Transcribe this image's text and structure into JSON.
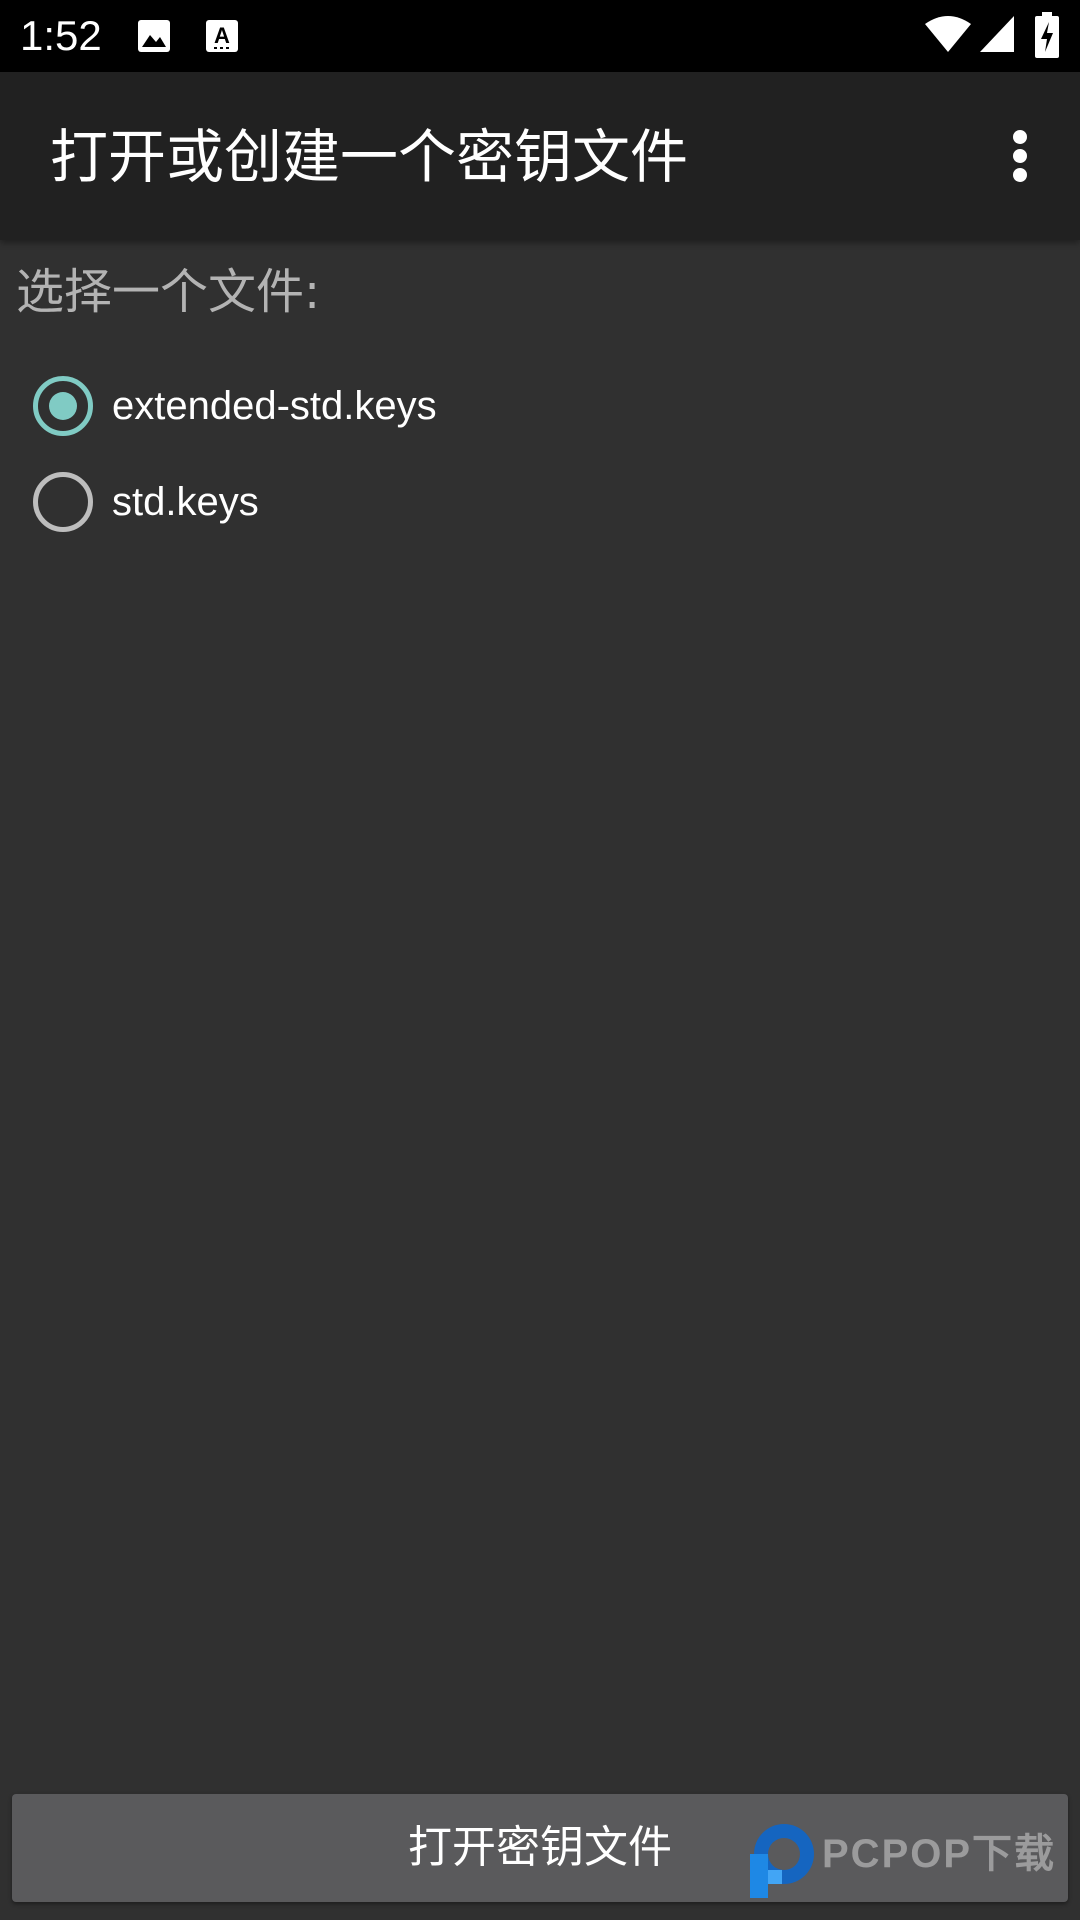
{
  "status_bar": {
    "time": "1:52",
    "icons": [
      "image-notification-icon",
      "keyboard-a-icon",
      "wifi-icon",
      "cell-signal-icon",
      "battery-charging-icon"
    ]
  },
  "app_bar": {
    "title": "打开或创建一个密钥文件",
    "menu_icon": "more-vert-icon"
  },
  "content": {
    "section_label": "选择一个文件:",
    "options": [
      {
        "label": "extended-std.keys",
        "checked": true
      },
      {
        "label": "std.keys",
        "checked": false
      }
    ]
  },
  "footer": {
    "open_button_label": "打开密钥文件"
  },
  "watermark": {
    "text": "PCPOP下载"
  },
  "colors": {
    "accent": "#80cbc4",
    "background": "#303030",
    "app_bar": "#212121",
    "button": "#5a5a5c"
  }
}
